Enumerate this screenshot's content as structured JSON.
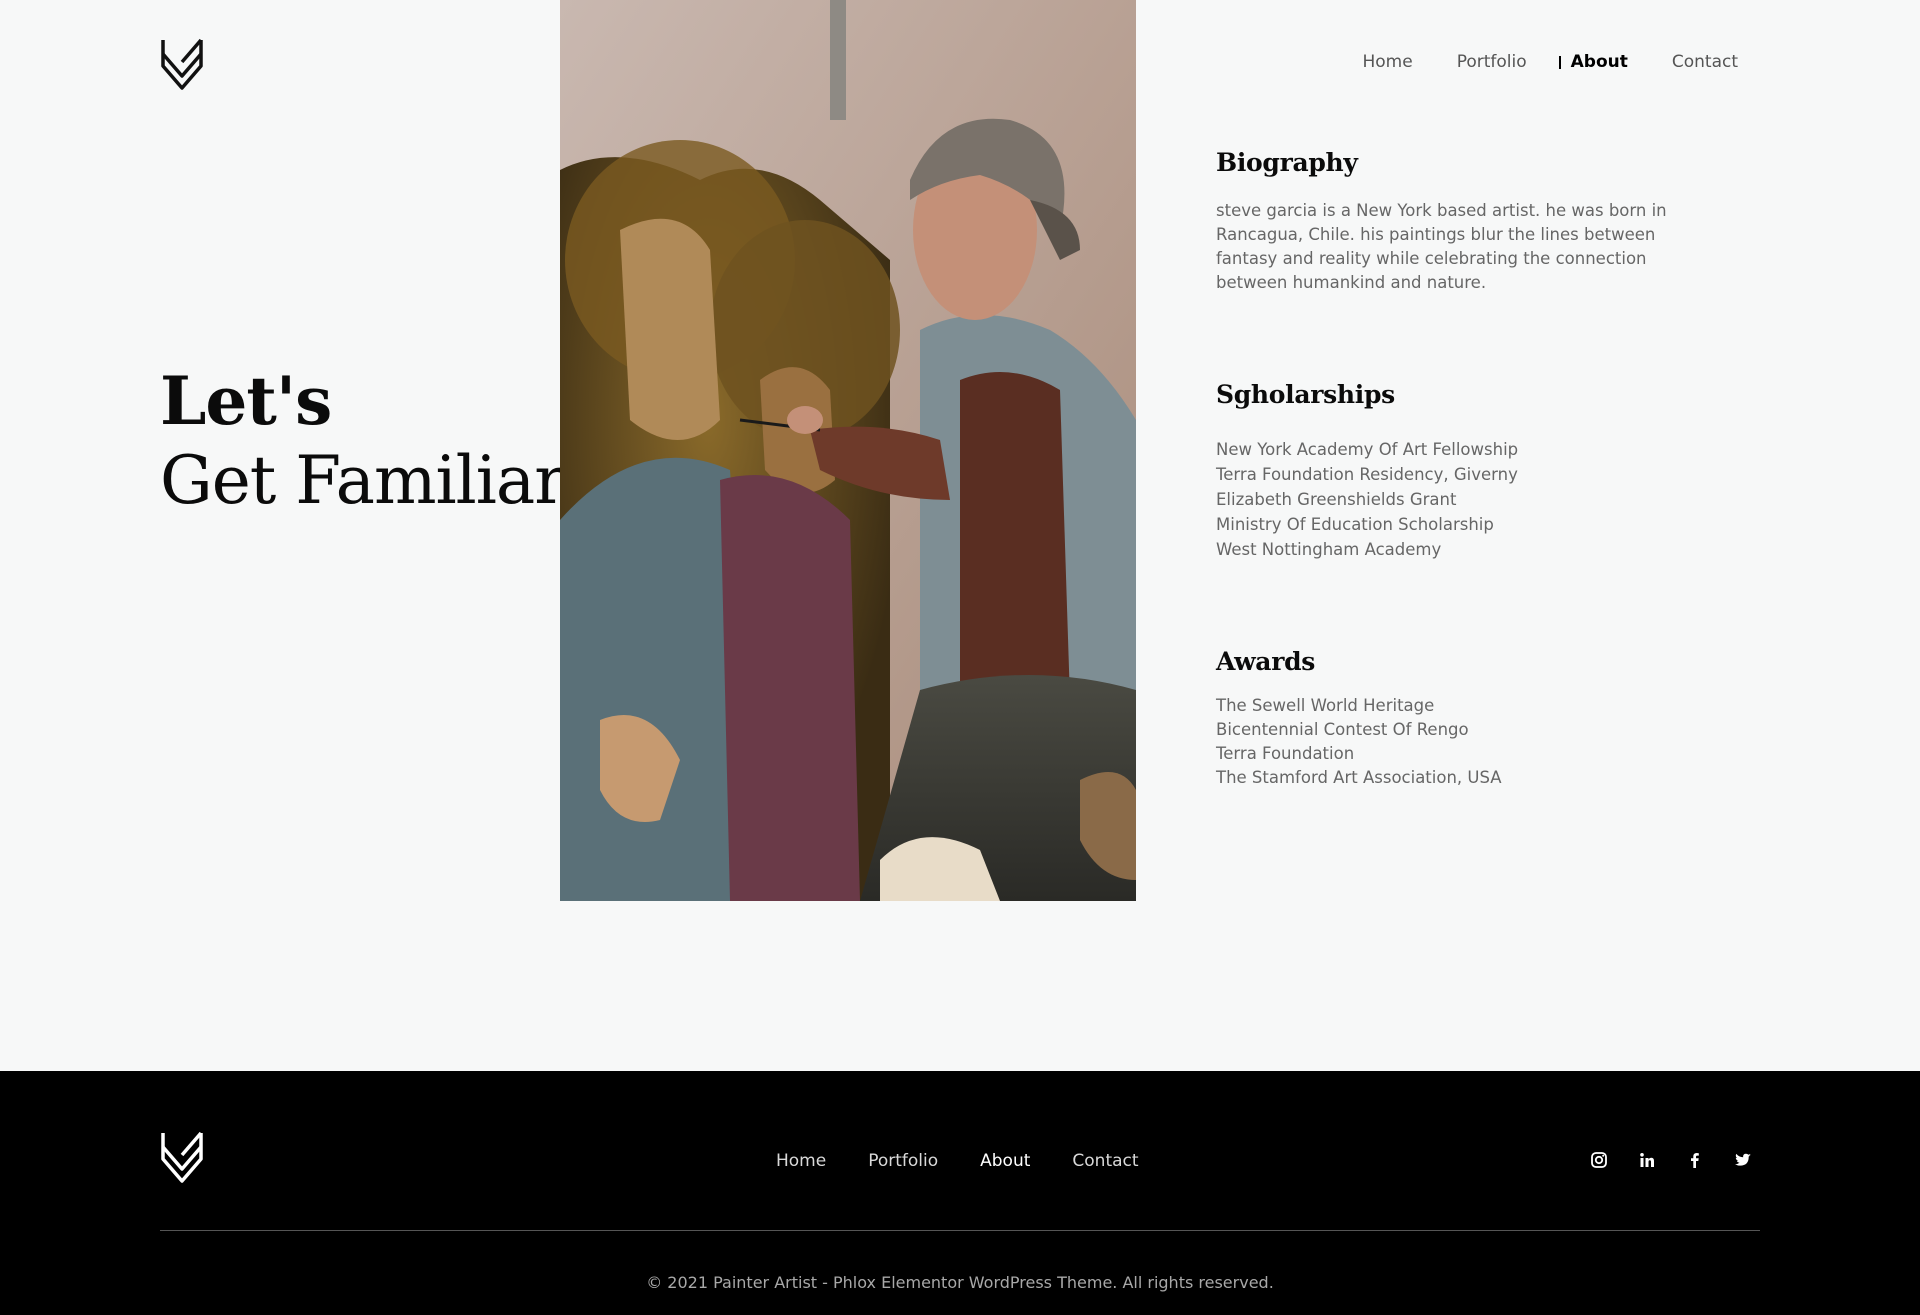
{
  "header": {
    "logo_icon": "chevron-v-logo-icon",
    "nav": [
      {
        "label": "Home",
        "active": false
      },
      {
        "label": "Portfolio",
        "active": false
      },
      {
        "label": "About",
        "active": true
      },
      {
        "label": "Contact",
        "active": false
      }
    ]
  },
  "hero": {
    "line1": "Let's",
    "line2": "Get Familiar"
  },
  "photo": {
    "subject": "painter-at-work-image"
  },
  "biography": {
    "title": "Biography",
    "text": "steve garcia is a New York based artist. he was born in Rancagua, Chile. his paintings blur the lines between fantasy and reality while celebrating the connection between humankind and nature."
  },
  "scholarships": {
    "title": "Sgholarships",
    "items": [
      "New York Academy Of Art Fellowship",
      "Terra Foundation Residency, Giverny",
      "Elizabeth Greenshields Grant",
      "Ministry Of Education Scholarship",
      "West Nottingham Academy"
    ]
  },
  "awards": {
    "title": "Awards",
    "items": [
      "The Sewell World Heritage",
      "Bicentennial Contest Of Rengo",
      "Terra Foundation",
      "The Stamford Art Association, USA"
    ]
  },
  "footer": {
    "nav": [
      {
        "label": "Home"
      },
      {
        "label": "Portfolio"
      },
      {
        "label": "About"
      },
      {
        "label": "Contact"
      }
    ],
    "social": [
      "instagram-icon",
      "linkedin-icon",
      "facebook-icon",
      "twitter-icon"
    ],
    "copyright": "© 2021 Painter Artist - Phlox Elementor WordPress Theme. All rights reserved."
  },
  "colors": {
    "background": "#f7f8f8",
    "footer_background": "#000000",
    "text_muted": "#666666"
  }
}
